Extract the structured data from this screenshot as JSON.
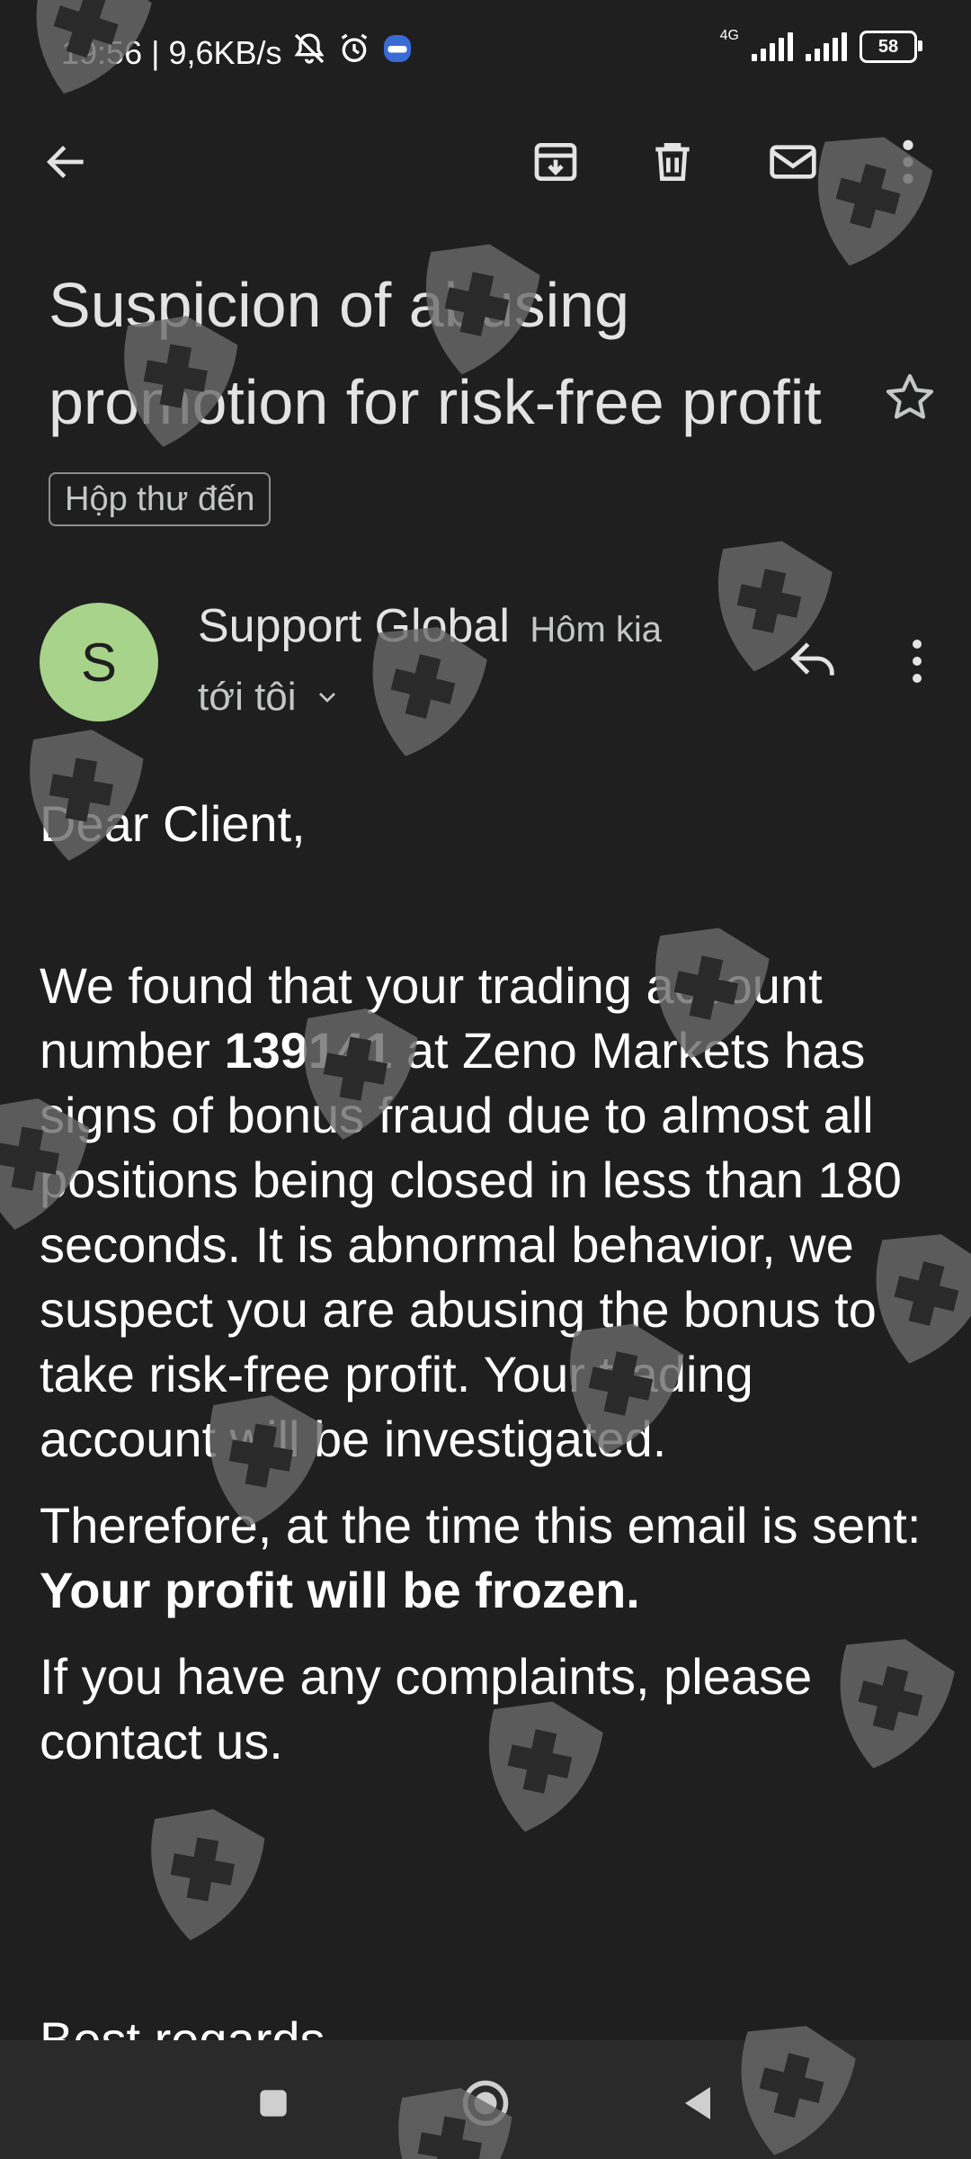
{
  "status_bar": {
    "time": "19:56",
    "network_speed": "9,6KB/s",
    "network_type": "4G",
    "battery": "58",
    "icons": [
      "bell-off-icon",
      "alarm-icon",
      "zalo-icon",
      "signal-icon",
      "signal-icon",
      "battery-icon"
    ]
  },
  "toolbar": {
    "icons": [
      "back-arrow-icon",
      "archive-icon",
      "delete-icon",
      "mark-unread-icon",
      "more-vert-icon"
    ]
  },
  "email": {
    "subject": "Suspicion of abusing promotion for risk-free profit",
    "label": "Hộp thư đến",
    "sender_initial": "S",
    "sender_name": "Support Global",
    "time": "Hôm kia",
    "recipient": "tới tôi",
    "greeting": "Dear Client,",
    "para1_a": "We found that your trading account number ",
    "account_number": "139141",
    "para1_b": " at Zeno Markets has signs of bonus fraud due to almost all positions being closed in less than 180 seconds. It is abnormal behavior, we suspect you are abusing the bonus to take risk-free profit. Your trading account will be investigated.",
    "para2_a": "Therefore, at the time this email is sent: ",
    "para2_bold": "Your profit will be frozen.",
    "para3": "If you have any complaints, please contact us.",
    "closing": "Best regards,"
  },
  "colors": {
    "background": "#1f1f1f",
    "avatar": "#a8d38a",
    "text": "#ffffff",
    "nav_bar": "#2a2a2a",
    "watermark": "#5a5a5a"
  }
}
